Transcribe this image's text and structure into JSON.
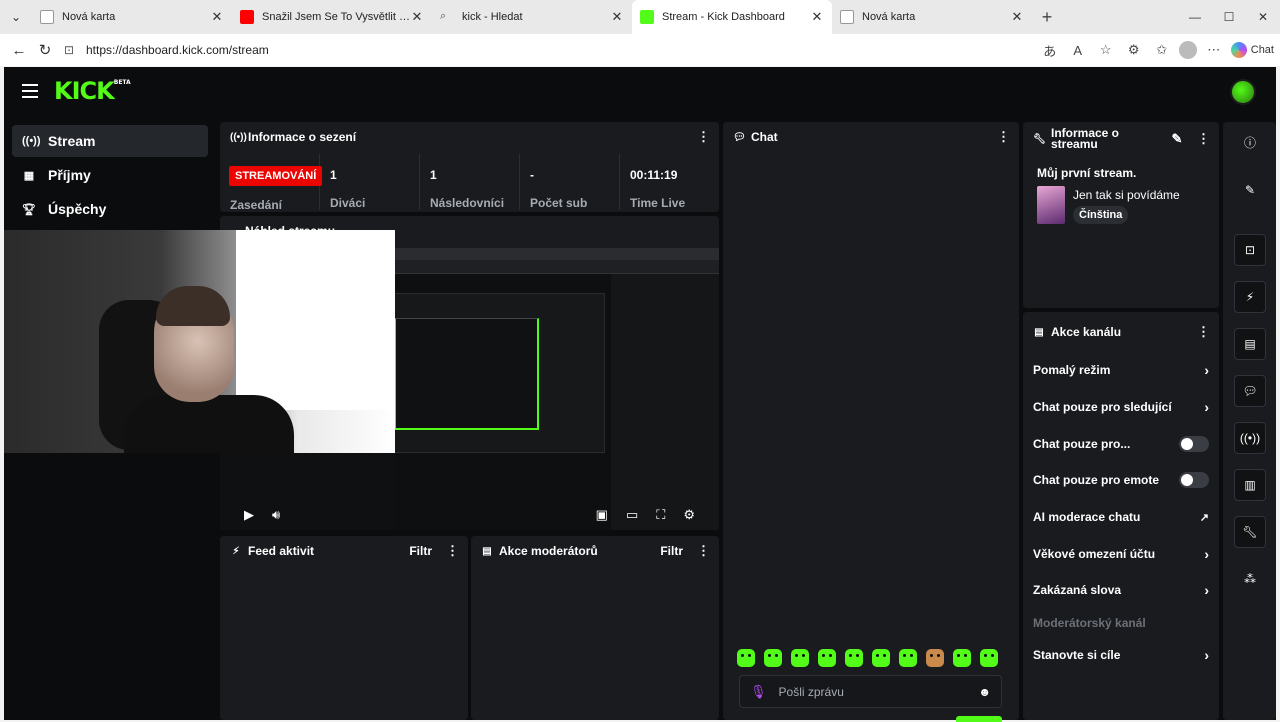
{
  "browser": {
    "tabs": [
      {
        "title": "Nová karta",
        "active": false,
        "fav_color": "#d5d5d5"
      },
      {
        "title": "Snažil Jsem Se To Vysvětlit - YouTube",
        "active": false,
        "fav_color": "#ff0000"
      },
      {
        "title": "kick - Hledat",
        "active": false,
        "fav_color": "#d5d5d5"
      },
      {
        "title": "Stream - Kick Dashboard",
        "active": true,
        "fav_color": "#53fc18"
      },
      {
        "title": "Nová karta",
        "active": false,
        "fav_color": "#d5d5d5"
      }
    ],
    "url": "https://dashboard.kick.com/stream",
    "chat_label": "Chat"
  },
  "app": {
    "logo": "KICK",
    "logo_beta": "BETA",
    "accent": "#53fc18",
    "sidebar": [
      {
        "label": "Stream",
        "icon": "broadcast-icon",
        "active": true
      },
      {
        "label": "Příjmy",
        "icon": "revenue-icon",
        "active": false
      },
      {
        "label": "Úspěchy",
        "icon": "trophy-icon",
        "active": false
      }
    ],
    "session": {
      "title": "Informace o sezení",
      "badge": "STREAMOVÁNÍ",
      "badge_label": "Zasedání",
      "stats": [
        {
          "value": "1",
          "label": "Diváci"
        },
        {
          "value": "1",
          "label": "Následovníci"
        },
        {
          "value": "-",
          "label": "Počet sub"
        },
        {
          "value": "00:11:19",
          "label": "Time Live"
        }
      ]
    },
    "preview": {
      "title": "Náhled streamu"
    },
    "feed": {
      "title": "Feed aktivit",
      "filter": "Filtr"
    },
    "mod_actions": {
      "title": "Akce moderátorů",
      "filter": "Filtr"
    },
    "chat": {
      "title": "Chat",
      "placeholder": "Pošli zprávu"
    },
    "stream_info": {
      "title_line1": "Informace o",
      "title_line2": "streamu",
      "stream_title": "Můj první stream.",
      "category": "Jen tak si povídáme",
      "language": "Čínština"
    },
    "channel_actions": {
      "title": "Akce kanálu",
      "items": [
        {
          "label": "Pomalý režim",
          "control": "chevron"
        },
        {
          "label": "Chat pouze pro sledující",
          "control": "chevron"
        },
        {
          "label": "Chat pouze pro...",
          "control": "toggle"
        },
        {
          "label": "Chat pouze pro emote",
          "control": "toggle"
        },
        {
          "label": "AI moderace chatu",
          "control": "external"
        },
        {
          "label": "Věkové omezení účtu",
          "control": "chevron"
        },
        {
          "label": "Zakázaná slova",
          "control": "chevron"
        },
        {
          "label": "Moderátorský kanál",
          "control": "none"
        },
        {
          "label": "Stanovte si cíle",
          "control": "chevron"
        }
      ]
    }
  }
}
